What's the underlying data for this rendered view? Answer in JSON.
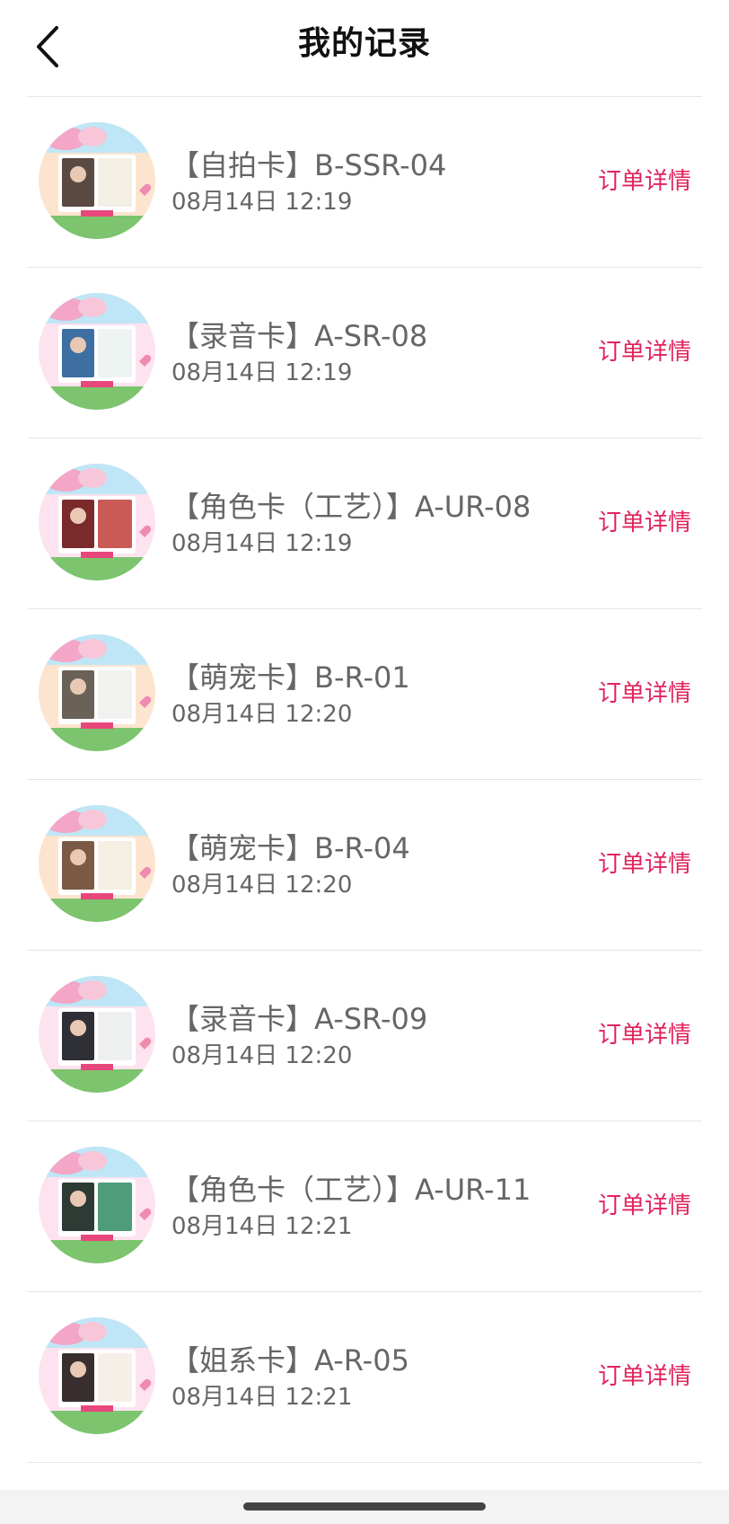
{
  "header": {
    "title": "我的记录",
    "back_icon": "chevron-left-icon"
  },
  "records": [
    {
      "title": "【自拍卡】B-SSR-04",
      "time": "08月14日 12:19",
      "detail_label": "订单详情",
      "bg": "#fde4cf",
      "photo": "#5a4a42",
      "card": "#f3efe4"
    },
    {
      "title": "【录音卡】A-SR-08",
      "time": "08月14日 12:19",
      "detail_label": "订单详情",
      "bg": "#fde3ef",
      "photo": "#3d6fa3",
      "card": "#eef4f1"
    },
    {
      "title": "【角色卡（工艺）】A-UR-08",
      "time": "08月14日 12:19",
      "detail_label": "订单详情",
      "bg": "#fde3ef",
      "photo": "#7a2a2a",
      "card": "#c95a55"
    },
    {
      "title": "【萌宠卡】B-R-01",
      "time": "08月14日 12:20",
      "detail_label": "订单详情",
      "bg": "#fde4cf",
      "photo": "#6a6257",
      "card": "#f1f1ef"
    },
    {
      "title": "【萌宠卡】B-R-04",
      "time": "08月14日 12:20",
      "detail_label": "订单详情",
      "bg": "#fde4cf",
      "photo": "#7a5a44",
      "card": "#f4efe2"
    },
    {
      "title": "【录音卡】A-SR-09",
      "time": "08月14日 12:20",
      "detail_label": "订单详情",
      "bg": "#fde3ef",
      "photo": "#2f2f36",
      "card": "#eef0f0"
    },
    {
      "title": "【角色卡（工艺）】A-UR-11",
      "time": "08月14日 12:21",
      "detail_label": "订单详情",
      "bg": "#fde3ef",
      "photo": "#2e3a34",
      "card": "#4f9c7a"
    },
    {
      "title": "【姐系卡】A-R-05",
      "time": "08月14日 12:21",
      "detail_label": "订单详情",
      "bg": "#fde3ef",
      "photo": "#3a2f2f",
      "card": "#f6efe8"
    }
  ],
  "colors": {
    "accent": "#e0245e",
    "text": "#666666",
    "divider": "#e6e6e6",
    "title": "#111111"
  }
}
